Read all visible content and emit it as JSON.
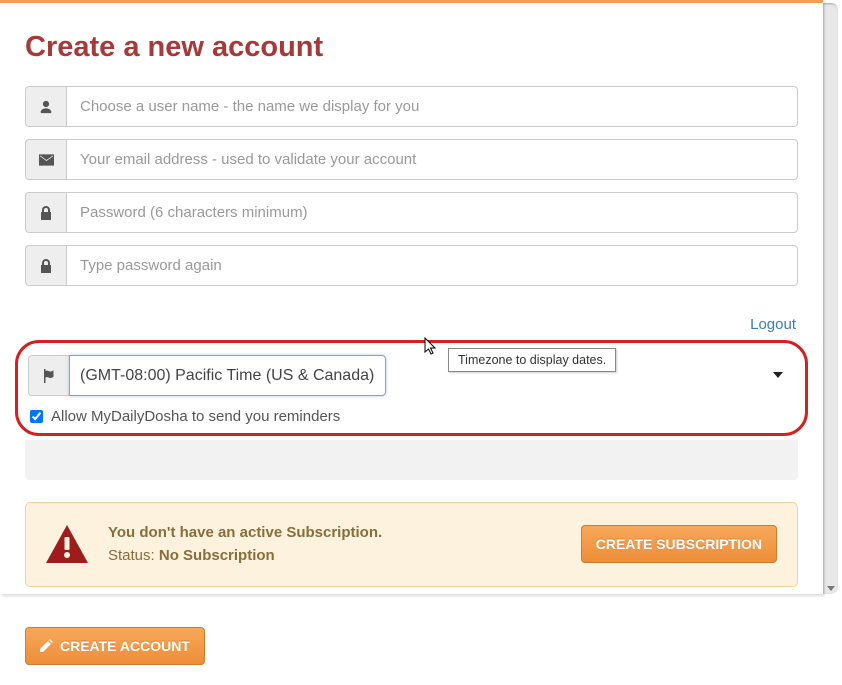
{
  "page": {
    "title": "Create a new account"
  },
  "form": {
    "username_placeholder": "Choose a user name - the name we display for you",
    "email_placeholder": "Your email address - used to validate your account",
    "password_placeholder": "Password (6 characters minimum)",
    "password2_placeholder": "Type password again",
    "timezone_value": "(GMT-08:00) Pacific Time (US & Canada)",
    "reminders_label": "Allow MyDailyDosha to send you reminders",
    "reminders_checked": true
  },
  "links": {
    "logout": "Logout"
  },
  "tooltip": {
    "timezone": "Timezone to display dates."
  },
  "subscription": {
    "message": "You don't have an active Subscription.",
    "status_label": "Status:",
    "status_value": "No Subscription",
    "button": "CREATE SUBSCRIPTION"
  },
  "submit": {
    "label": "CREATE ACCOUNT"
  },
  "colors": {
    "heading": "#a43a3a",
    "accent_orange": "#f29544",
    "highlight_border": "#d32020",
    "alert_bg": "#fdf2de",
    "alert_icon": "#9e1c1c"
  }
}
